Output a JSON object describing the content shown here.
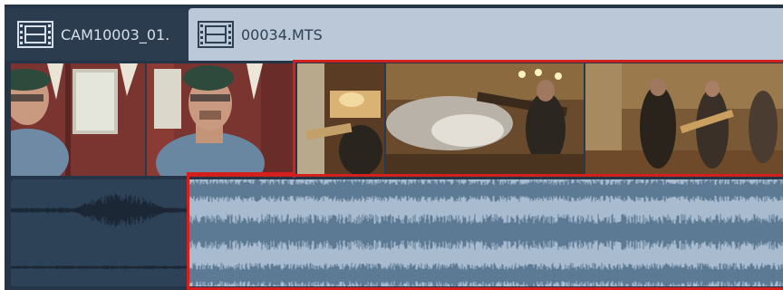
{
  "clips": [
    {
      "name": "CAM10003_01.",
      "icon": "film-strip-icon"
    },
    {
      "name": "00034.MTS",
      "icon": "film-strip-icon"
    }
  ],
  "colors": {
    "timeline_bg": "#243548",
    "selection": "#d3201f",
    "waveform": "#5d7a95",
    "audio_selected_bg": "#a9bccf",
    "audio_unselected_bg": "#2d4157"
  },
  "selection": {
    "clip": "00034.MTS"
  }
}
